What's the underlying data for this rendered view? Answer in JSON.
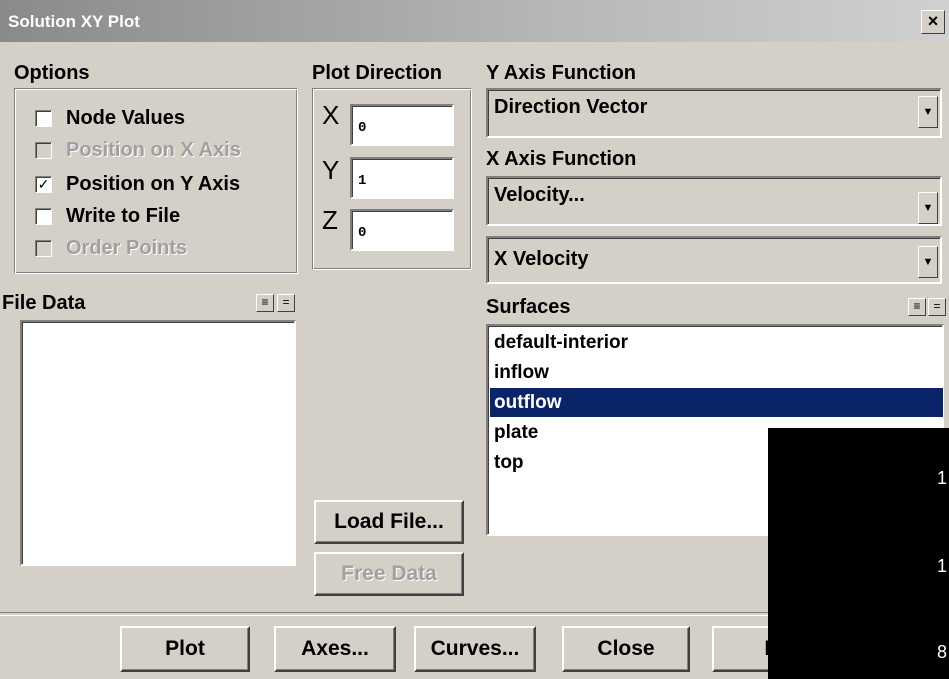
{
  "window": {
    "title": "Solution XY Plot",
    "close_glyph": "×"
  },
  "options": {
    "label": "Options",
    "items": [
      {
        "label": "Node Values",
        "checked": false,
        "enabled": true
      },
      {
        "label": "Position on X Axis",
        "checked": false,
        "enabled": false
      },
      {
        "label": "Position on Y Axis",
        "checked": true,
        "enabled": true,
        "mark": "✓"
      },
      {
        "label": "Write to File",
        "checked": false,
        "enabled": true
      },
      {
        "label": "Order Points",
        "checked": false,
        "enabled": false
      }
    ]
  },
  "plot_direction": {
    "label": "Plot Direction",
    "x_label": "X",
    "x_value": "0",
    "y_label": "Y",
    "y_value": "1",
    "z_label": "Z",
    "z_value": "0"
  },
  "y_axis_function": {
    "label": "Y Axis Function",
    "value": "Direction Vector"
  },
  "x_axis_function": {
    "label": "X Axis Function",
    "value": "Velocity...",
    "sub_value": "X Velocity"
  },
  "file_data": {
    "label": "File Data"
  },
  "surfaces": {
    "label": "Surfaces",
    "items": [
      "default-interior",
      "inflow",
      "outflow",
      "plate",
      "top"
    ],
    "selected": "outflow"
  },
  "buttons": {
    "load_file": "Load File...",
    "free_data": "Free Data",
    "plot": "Plot",
    "axes": "Axes...",
    "curves": "Curves...",
    "close": "Close",
    "help": "H"
  },
  "overlay": {
    "lines": [
      "1",
      "1",
      "8"
    ]
  },
  "colors": {
    "dialog_bg": "#d4d0c8",
    "selection": "#0a246a"
  }
}
